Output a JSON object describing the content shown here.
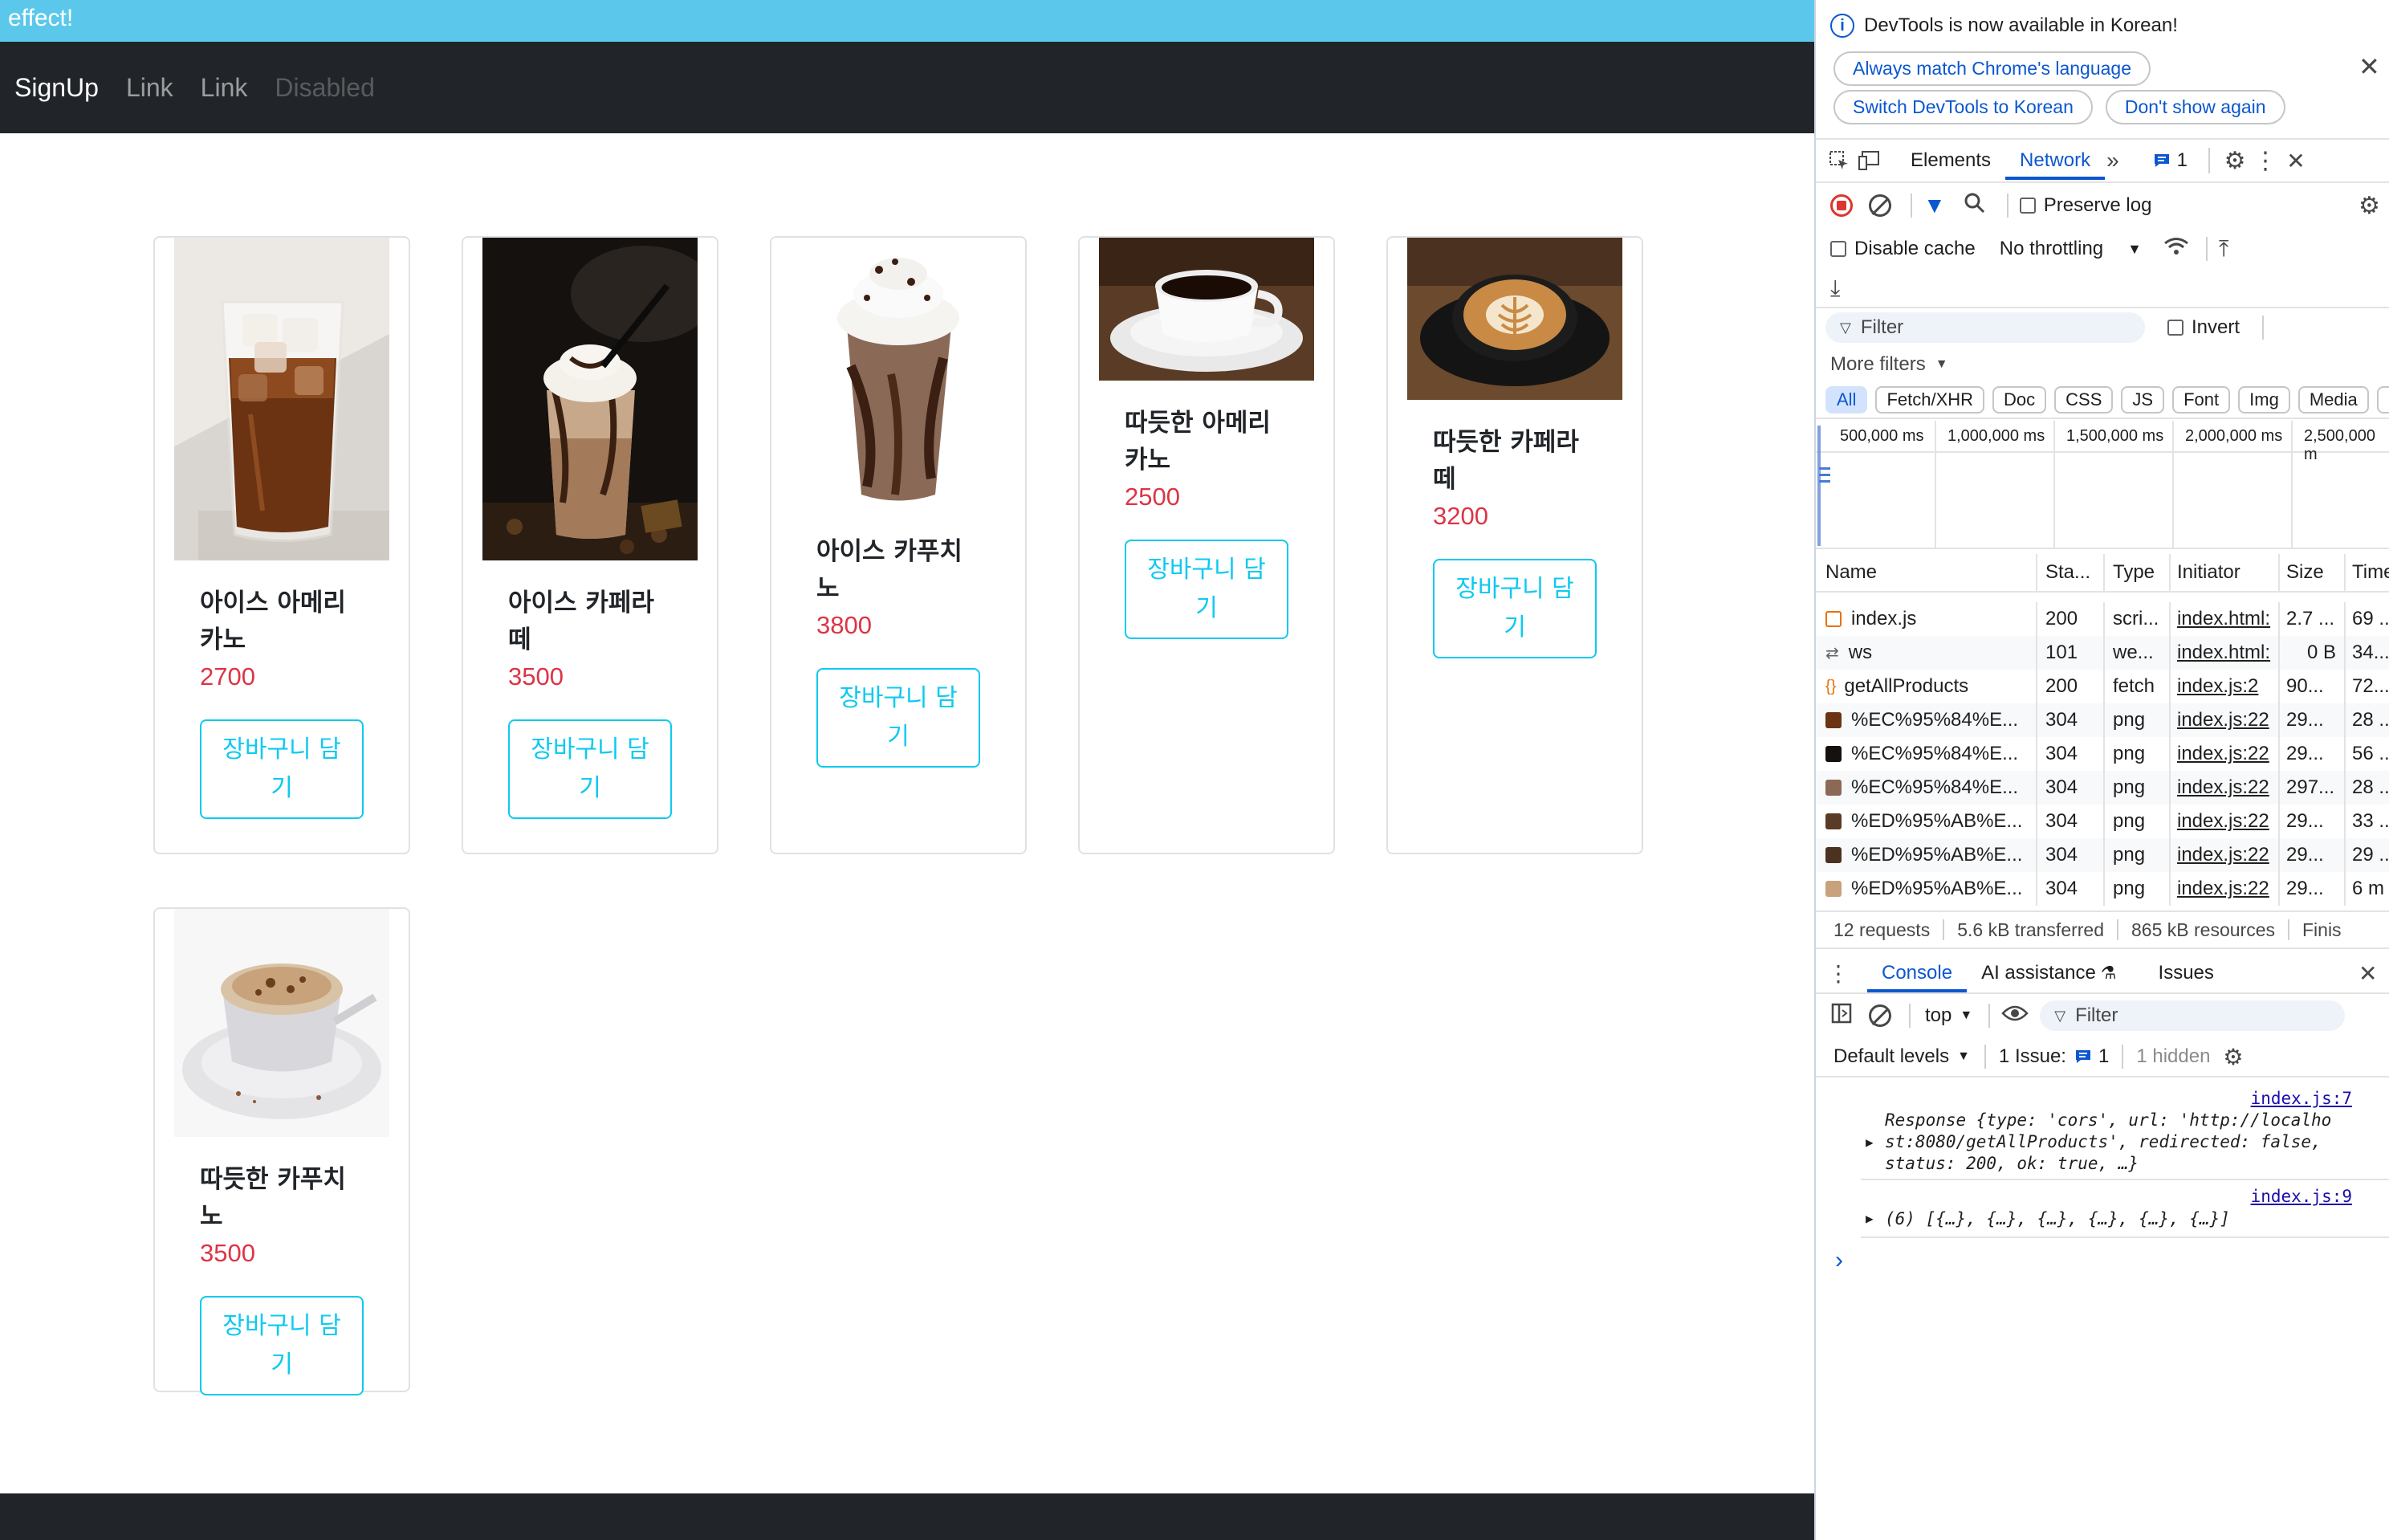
{
  "page": {
    "banner_text": "effect!",
    "nav": {
      "brand": "SignUp",
      "links": [
        "Link",
        "Link"
      ],
      "disabled": "Disabled"
    },
    "cart_button_label": "장바구니 담기",
    "products": [
      {
        "name": "아이스 아메리카노",
        "price": "2700",
        "image": "iced-americano"
      },
      {
        "name": "아이스 카페라떼",
        "price": "3500",
        "image": "iced-cafe-latte"
      },
      {
        "name": "아이스 카푸치노",
        "price": "3800",
        "image": "iced-cappuccino"
      },
      {
        "name": "따듯한 아메리카노",
        "price": "2500",
        "image": "hot-americano"
      },
      {
        "name": "따듯한 카페라떼",
        "price": "3200",
        "image": "hot-cafe-latte"
      },
      {
        "name": "따듯한 카푸치노",
        "price": "3500",
        "image": "hot-cappuccino"
      }
    ]
  },
  "devtools": {
    "notice": {
      "text": "DevTools is now available in Korean!",
      "buttons": [
        "Always match Chrome's language",
        "Switch DevTools to Korean",
        "Don't show again"
      ]
    },
    "tabs": [
      "Elements",
      "Network"
    ],
    "active_tab": "Network",
    "messages_count": "1",
    "toolbar": {
      "preserve_log": "Preserve log",
      "disable_cache": "Disable cache",
      "throttling": "No throttling"
    },
    "filter": {
      "placeholder": "Filter",
      "invert": "Invert",
      "more_filters": "More filters",
      "types": [
        "All",
        "Fetch/XHR",
        "Doc",
        "CSS",
        "JS",
        "Font",
        "Img",
        "Media",
        "M"
      ]
    },
    "timeline_ticks": [
      "500,000 ms",
      "1,000,000 ms",
      "1,500,000 ms",
      "2,000,000 ms",
      "2,500,000 m"
    ],
    "table": {
      "headers": [
        "Name",
        "Sta...",
        "Type",
        "Initiator",
        "Size",
        "Time"
      ],
      "rows": [
        {
          "name": "index.js",
          "status": "200",
          "type": "scri...",
          "initiator": "index.html:",
          "size": "2.7 ...",
          "time": "69 ..."
        },
        {
          "name": "ws",
          "status": "101",
          "type": "we...",
          "initiator": "index.html:",
          "size": "0 B",
          "time": "34...."
        },
        {
          "name": "getAllProducts",
          "status": "200",
          "type": "fetch",
          "initiator": "index.js:2",
          "size": "90...",
          "time": "72...."
        },
        {
          "name": "%EC%95%84%E...",
          "status": "304",
          "type": "png",
          "initiator": "index.js:22",
          "size": "29...",
          "time": "28 ..."
        },
        {
          "name": "%EC%95%84%E...",
          "status": "304",
          "type": "png",
          "initiator": "index.js:22",
          "size": "29...",
          "time": "56 ..."
        },
        {
          "name": "%EC%95%84%E...",
          "status": "304",
          "type": "png",
          "initiator": "index.js:22",
          "size": "297...",
          "time": "28 ..."
        },
        {
          "name": "%ED%95%AB%E...",
          "status": "304",
          "type": "png",
          "initiator": "index.js:22",
          "size": "29...",
          "time": "33 ..."
        },
        {
          "name": "%ED%95%AB%E...",
          "status": "304",
          "type": "png",
          "initiator": "index.js:22",
          "size": "29...",
          "time": "29 ..."
        },
        {
          "name": "%ED%95%AB%E...",
          "status": "304",
          "type": "png",
          "initiator": "index.js:22",
          "size": "29...",
          "time": "6 m"
        }
      ]
    },
    "summary": [
      "12 requests",
      "5.6 kB transferred",
      "865 kB resources",
      "Finis"
    ],
    "drawer_tabs": [
      "Console",
      "AI assistance",
      "Issues"
    ],
    "console": {
      "context": "top",
      "filter_placeholder": "Filter",
      "levels": "Default levels",
      "issues_label": "1 Issue:",
      "issues_count": "1",
      "hidden": "1 hidden",
      "entries": [
        {
          "source": "index.js:7",
          "line1": "Response {type: 'cors', url: 'http://localho",
          "line2": "st:8080/getAllProducts', redirected: false,",
          "line3": "status: 200, ok: true, …}"
        },
        {
          "source": "index.js:9",
          "line1": "(6) [{…}, {…}, {…}, {…}, {…}, {…}]"
        }
      ],
      "prompt": "›"
    }
  }
}
